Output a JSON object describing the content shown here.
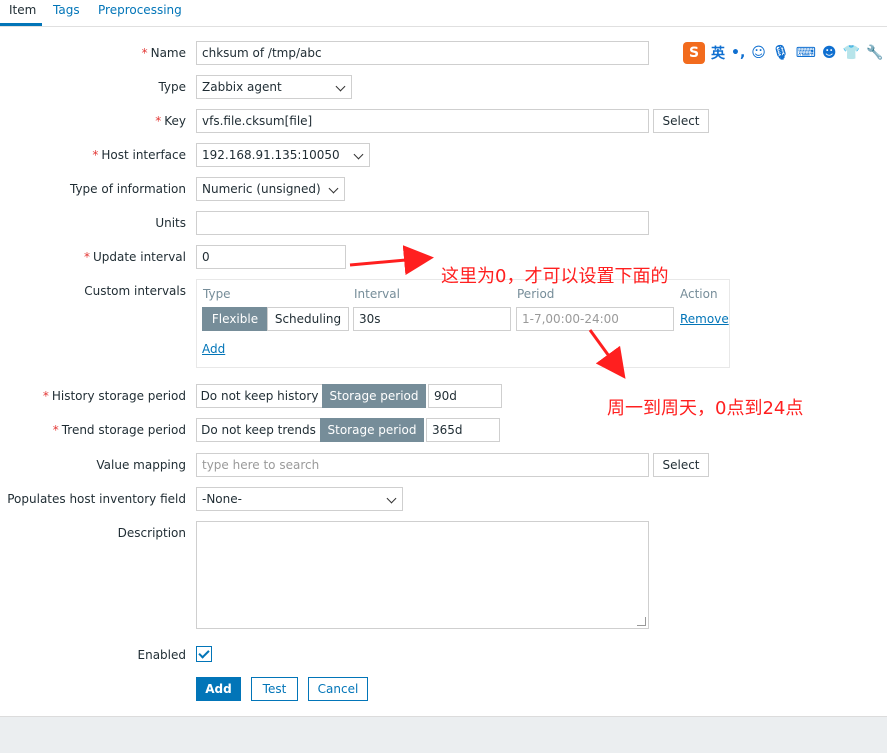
{
  "tabs": [
    {
      "label": "Item",
      "active": true
    },
    {
      "label": "Tags",
      "active": false
    },
    {
      "label": "Preprocessing",
      "active": false
    }
  ],
  "form": {
    "name": {
      "label": "Name",
      "required": true,
      "value": "chksum of /tmp/abc"
    },
    "type": {
      "label": "Type",
      "value": "Zabbix agent"
    },
    "key": {
      "label": "Key",
      "required": true,
      "value": "vfs.file.cksum[file]",
      "select_label": "Select"
    },
    "host_interface": {
      "label": "Host interface",
      "required": true,
      "value": "192.168.91.135:10050"
    },
    "type_of_information": {
      "label": "Type of information",
      "value": "Numeric (unsigned)"
    },
    "units": {
      "label": "Units",
      "value": ""
    },
    "update_interval": {
      "label": "Update interval",
      "required": true,
      "value": "0"
    },
    "custom_intervals": {
      "label": "Custom intervals",
      "headers": {
        "type": "Type",
        "interval": "Interval",
        "period": "Period",
        "action": "Action"
      },
      "row": {
        "flexible": "Flexible",
        "scheduling": "Scheduling",
        "interval": "30s",
        "period_placeholder": "1-7,00:00-24:00",
        "remove": "Remove"
      },
      "add": "Add"
    },
    "history": {
      "label": "History storage period",
      "required": true,
      "off": "Do not keep history",
      "on": "Storage period",
      "value": "90d"
    },
    "trend": {
      "label": "Trend storage period",
      "required": true,
      "off": "Do not keep trends",
      "on": "Storage period",
      "value": "365d"
    },
    "value_mapping": {
      "label": "Value mapping",
      "placeholder": "type here to search",
      "select_label": "Select"
    },
    "inventory": {
      "label": "Populates host inventory field",
      "value": "-None-"
    },
    "description": {
      "label": "Description",
      "value": ""
    },
    "enabled": {
      "label": "Enabled",
      "checked": true
    }
  },
  "actions": {
    "add": "Add",
    "test": "Test",
    "cancel": "Cancel"
  },
  "annotations": {
    "note1": "这里为0，才可以设置下面的",
    "note2": "周一到周天，0点到24点"
  },
  "ime_toolbar": {
    "logo": "S",
    "lang": "英",
    "punct": "•,"
  },
  "colors": {
    "accent": "#0275b8",
    "required": "#e33734",
    "annotation": "#ff1f1f",
    "segment_on": "#768d99"
  }
}
